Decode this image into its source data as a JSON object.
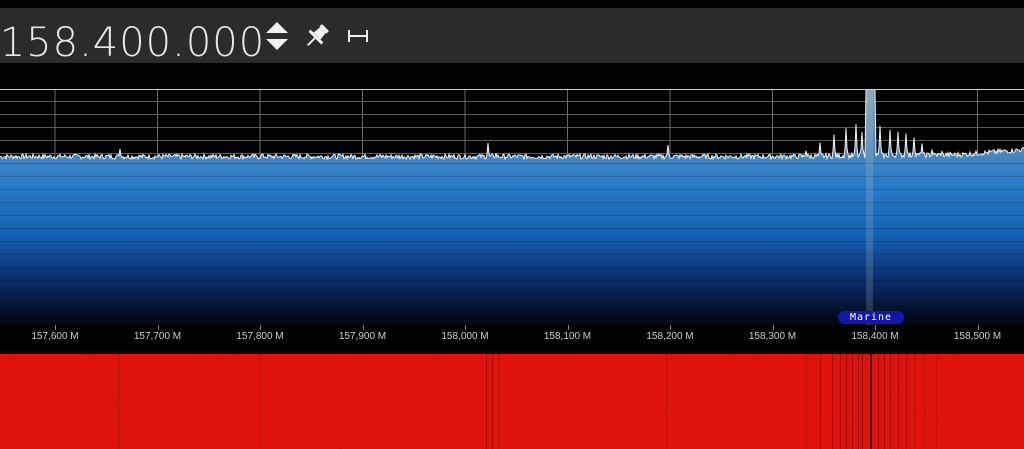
{
  "toolbar": {
    "frequency_display": ".158.400.000",
    "icons": [
      "up-down-arrows-icon",
      "pin-icon",
      "span-icon"
    ]
  },
  "spectrum": {
    "tuned_frequency_mhz": 158.4,
    "band_label": "Marine",
    "fill_colors": [
      "#7a9db3",
      "#3a7fc0",
      "#1f6fbf",
      "#0c2f6e",
      "#000514"
    ],
    "trace_color": "#f2f2f2"
  },
  "axis": {
    "ticks": [
      {
        "label": "157,600 M",
        "freq_mhz": 157.6
      },
      {
        "label": "157,700 M",
        "freq_mhz": 157.7
      },
      {
        "label": "157,800 M",
        "freq_mhz": 157.8
      },
      {
        "label": "157,900 M",
        "freq_mhz": 157.9
      },
      {
        "label": "158,000 M",
        "freq_mhz": 158.0
      },
      {
        "label": "158,100 M",
        "freq_mhz": 158.1
      },
      {
        "label": "158,200 M",
        "freq_mhz": 158.2
      },
      {
        "label": "158,300 M",
        "freq_mhz": 158.3
      },
      {
        "label": "158,400 M",
        "freq_mhz": 158.4
      },
      {
        "label": "158,500 M",
        "freq_mhz": 158.5
      }
    ]
  },
  "waterfall": {
    "base_color": "#e0130c"
  }
}
